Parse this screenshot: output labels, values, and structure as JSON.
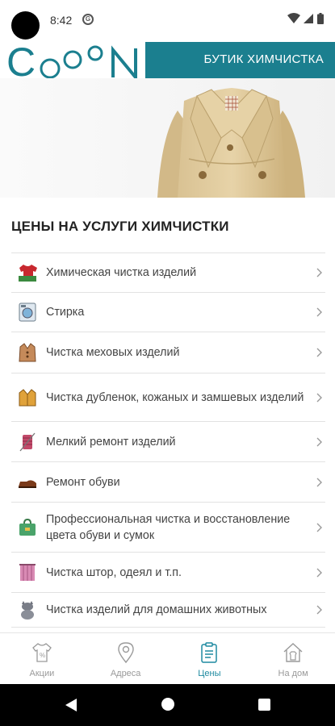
{
  "status_bar": {
    "time": "8:42"
  },
  "header": {
    "logo_text": "COOON",
    "title": "БУТИК ХИМЧИСТКА"
  },
  "section": {
    "title": "ЦЕНЫ НА УСЛУГИ ХИМЧИСТКИ"
  },
  "services": [
    {
      "label": "Химическая чистка изделий",
      "icon": "shirt-icon"
    },
    {
      "label": "Стирка",
      "icon": "washing-machine-icon"
    },
    {
      "label": "Чистка меховых изделий",
      "icon": "fur-coat-icon"
    },
    {
      "label": "Чистка дубленок, кожаных и замшевых изделий",
      "icon": "leather-jacket-icon"
    },
    {
      "label": "Мелкий ремонт изделий",
      "icon": "sewing-thread-icon"
    },
    {
      "label": "Ремонт обуви",
      "icon": "shoe-icon"
    },
    {
      "label": "Профессиональная чистка и восстановление цвета обуви и сумок",
      "icon": "bag-icon"
    },
    {
      "label": "Чистка штор, одеял и т.п.",
      "icon": "curtain-icon"
    },
    {
      "label": "Чистка изделий для домашних животных",
      "icon": "cat-icon"
    }
  ],
  "bottom_nav": [
    {
      "label": "Акции",
      "icon": "sale-tag-icon",
      "active": false
    },
    {
      "label": "Адреса",
      "icon": "location-pin-icon",
      "active": false
    },
    {
      "label": "Цены",
      "icon": "price-list-icon",
      "active": true
    },
    {
      "label": "На дом",
      "icon": "home-delivery-icon",
      "active": false
    }
  ],
  "colors": {
    "brand": "#1b7f8f",
    "active_nav": "#1e8aa0"
  }
}
